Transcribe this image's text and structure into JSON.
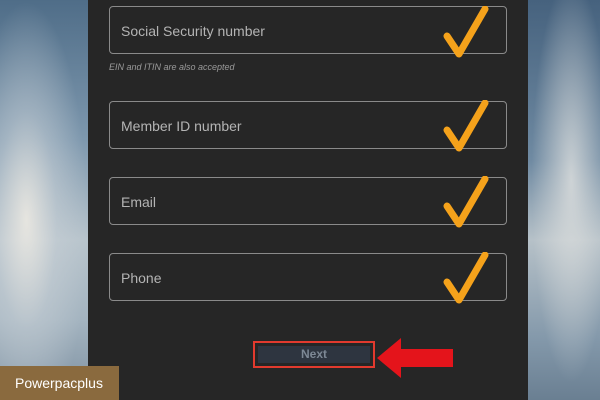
{
  "form": {
    "fields": [
      {
        "label": "Social Security number"
      },
      {
        "label": "Member ID number"
      },
      {
        "label": "Email"
      },
      {
        "label": "Phone"
      }
    ],
    "ssn_hint": "EIN and ITIN are also accepted",
    "next_label": "Next"
  },
  "overlay": {
    "watermark": "Powerpacplus",
    "checkmark_color": "#f5a21b",
    "highlight_color": "#e23a2e",
    "arrow_color": "#e4141b",
    "check_icon": "checkmark-icon",
    "arrow_icon": "arrow-left-icon"
  }
}
